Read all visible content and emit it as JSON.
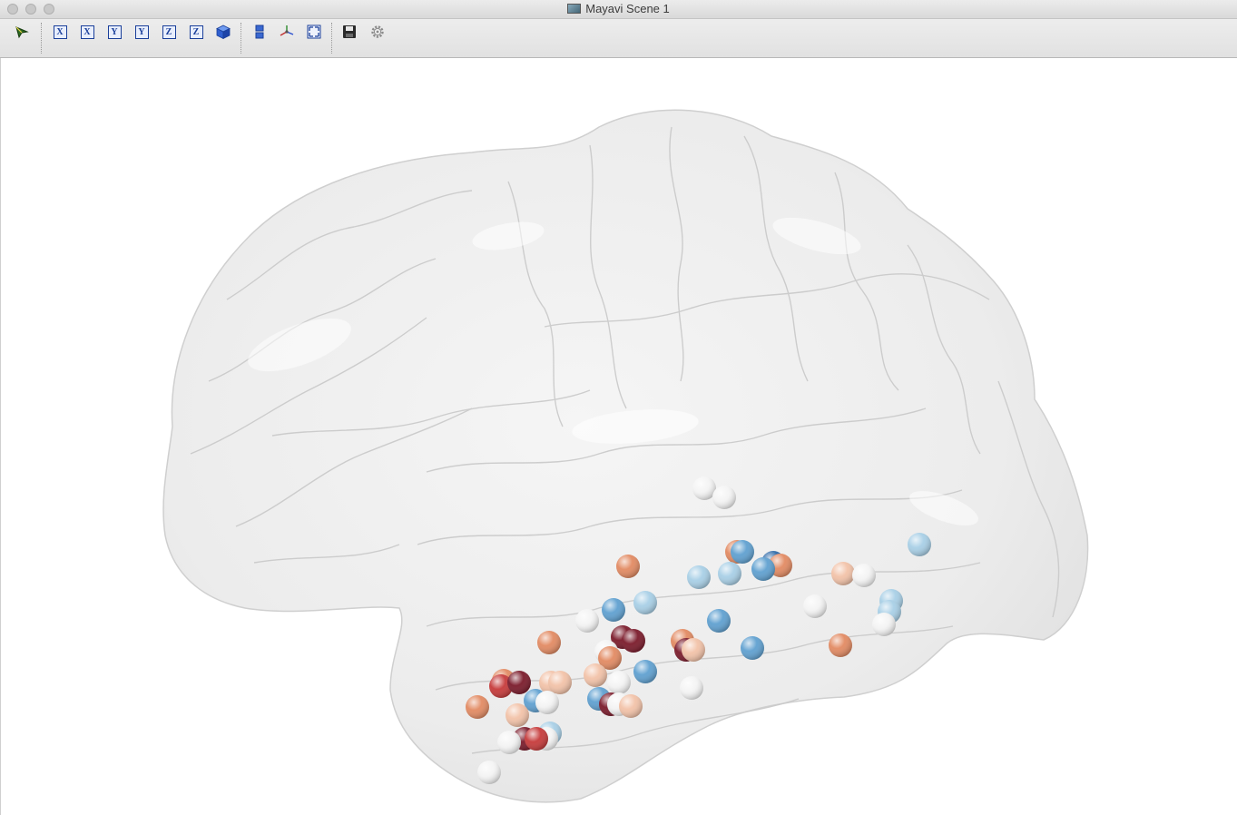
{
  "window": {
    "title": "Mayavi Scene 1"
  },
  "toolbar": {
    "buttons": [
      {
        "name": "select-tool-button",
        "icon": "pointer-icon"
      },
      {
        "name": "view-x-positive-button",
        "label": "X"
      },
      {
        "name": "view-x-negative-button",
        "label": "X"
      },
      {
        "name": "view-y-positive-button",
        "label": "Y"
      },
      {
        "name": "view-y-negative-button",
        "label": "Y"
      },
      {
        "name": "view-z-positive-button",
        "label": "Z"
      },
      {
        "name": "view-z-negative-button",
        "label": "Z"
      },
      {
        "name": "isometric-view-button",
        "icon": "cube-icon"
      },
      {
        "name": "parallel-projection-button",
        "icon": "projection-icon"
      },
      {
        "name": "show-axes-button",
        "icon": "axes-icon"
      },
      {
        "name": "fullscreen-button",
        "icon": "fullscreen-icon"
      },
      {
        "name": "save-button",
        "icon": "save-icon"
      },
      {
        "name": "configure-button",
        "icon": "gear-icon"
      }
    ]
  },
  "scene": {
    "surface": "translucent brain surface",
    "colors": {
      "dark_red": "#7a1a2a",
      "red": "#c63a3a",
      "orange": "#e28a62",
      "peach": "#f2c2a8",
      "white": "#f4f4f4",
      "light_blue": "#a8cfe6",
      "blue": "#5fa0d0",
      "dark_blue": "#2f6aa8"
    }
  }
}
